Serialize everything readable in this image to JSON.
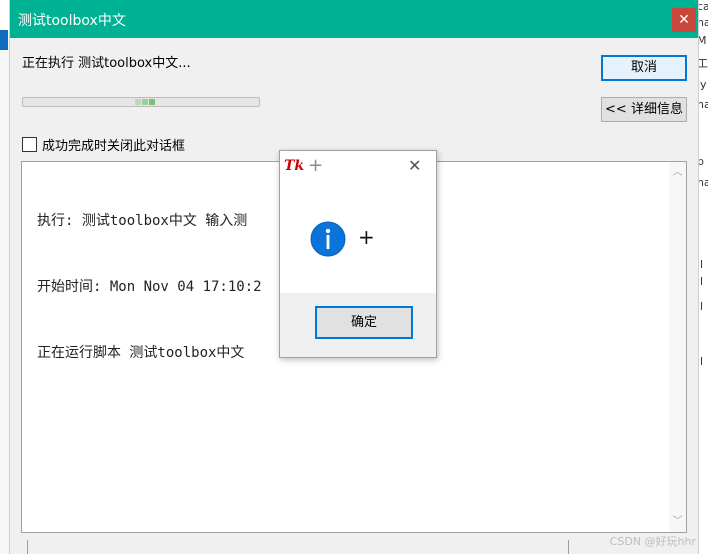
{
  "window": {
    "title": "测试toolbox中文",
    "close_glyph": "✕"
  },
  "status": {
    "text": "正在执行 测试toolbox中文..."
  },
  "progress": {
    "filled_fraction": 0.55
  },
  "buttons": {
    "cancel": "取消",
    "details": "<< 详细信息"
  },
  "checkbox": {
    "label": "成功完成时关闭此对话框",
    "checked": false
  },
  "log": {
    "lines": [
      "执行: 测试toolbox中文 输入测",
      "开始时间: Mon Nov 04 17:10:2",
      "正在运行脚本 测试toolbox中文"
    ]
  },
  "message_box": {
    "logo_text": "Tk",
    "title_symbol": "+",
    "close_glyph": "✕",
    "icon": "info-icon",
    "message": "+",
    "ok_label": "确定"
  },
  "background_right": [
    "ca",
    "na",
    "M",
    "工",
    "ly",
    "na",
    "b",
    "na",
    "ll",
    "ll",
    "ll",
    "l",
    "ll"
  ],
  "watermark": "CSDN @好玩hhr",
  "colors": {
    "titlebar": "#00b294",
    "close_button": "#c9463b",
    "focus_border": "#0078d7",
    "info_icon": "#0a74da"
  }
}
